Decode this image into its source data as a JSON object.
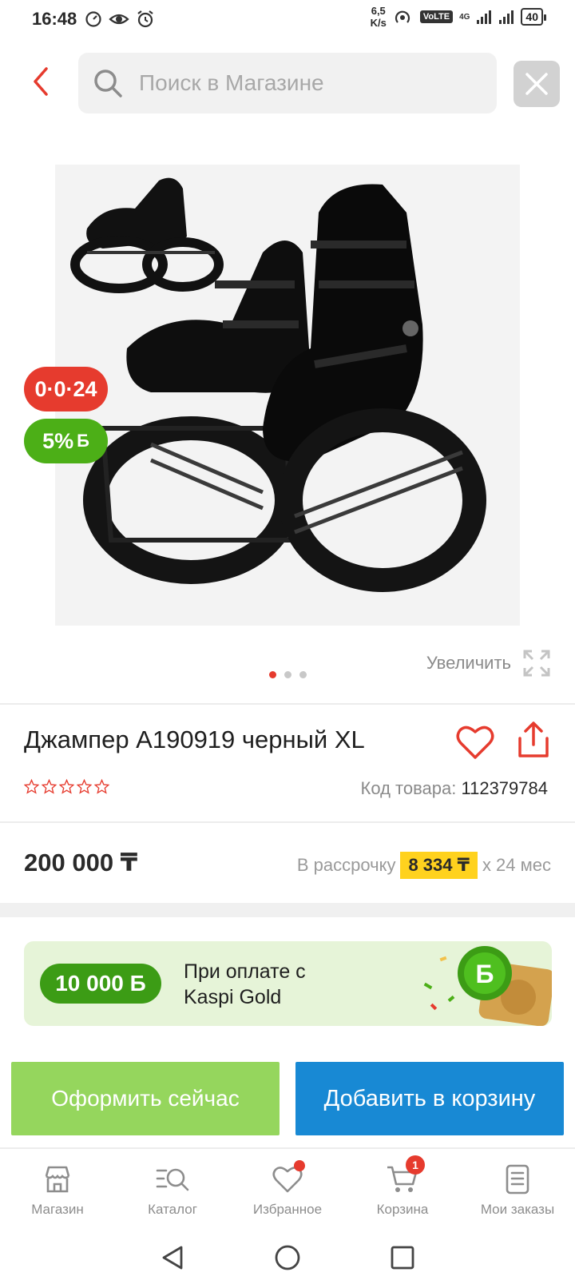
{
  "status_bar": {
    "time": "16:48",
    "speed_value": "6,5",
    "speed_unit": "K/s",
    "volte": "VoLTE",
    "network": "4G",
    "battery": "40"
  },
  "search": {
    "placeholder": "Поиск в Магазине"
  },
  "product": {
    "badge_installment": "0·0·24",
    "badge_bonus": "5%",
    "badge_bonus_currency": "Б",
    "zoom_label": "Увеличить",
    "title": "Джампер A190919 черный XL",
    "rating_stars": 0,
    "sku_label": "Код товара:",
    "sku_value": "112379784",
    "price": "200 000 ₸",
    "installment_label": "В рассрочку",
    "installment_amount": "8 334 ₸",
    "installment_term": "х 24 мес"
  },
  "promo": {
    "amount": "10 000 Б",
    "text": "При оплате с Kaspi Gold"
  },
  "actions": {
    "checkout": "Оформить сейчас",
    "add_to_cart": "Добавить в корзину"
  },
  "tabbar": {
    "items": [
      {
        "label": "Магазин",
        "icon": "store-icon"
      },
      {
        "label": "Каталог",
        "icon": "catalog-icon"
      },
      {
        "label": "Избранное",
        "icon": "heart-icon"
      },
      {
        "label": "Корзина",
        "icon": "cart-icon"
      },
      {
        "label": "Мои заказы",
        "icon": "orders-icon"
      }
    ],
    "cart_count": "1"
  },
  "colors": {
    "accent_red": "#e63b2e",
    "bonus_green": "#4caf17",
    "checkout_green": "#95d65d",
    "cart_blue": "#1889d4",
    "installment_yellow": "#ffd21e"
  }
}
